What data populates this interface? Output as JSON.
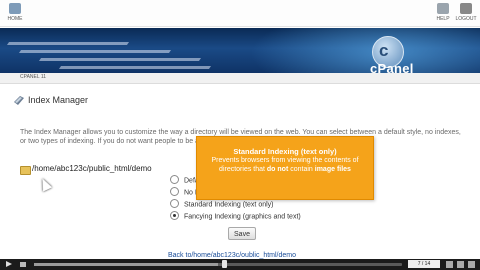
{
  "topbar": {
    "home_label": "HOME",
    "help_label": "HELP",
    "logout_label": "LOGOUT"
  },
  "brand": {
    "logo_letter": "c",
    "name": "cPanel"
  },
  "breadcrumb": {
    "text": "CPANEL 11"
  },
  "page": {
    "title": "Index Manager"
  },
  "description": "The Index Manager allows you to customize the way a directory will be viewed on the web. You can select between a default style, no indexes, or two types of indexing. If you do not want people to be able to see the files in your directory, choose no indexing.",
  "directory": {
    "path": "/home/abc123c/public_html/demo"
  },
  "options": [
    {
      "label": "Default System Setting",
      "selected": false
    },
    {
      "label": "No Indexing",
      "selected": false
    },
    {
      "label": "Standard Indexing (text only)",
      "selected": false
    },
    {
      "label": "Fancying Indexing (graphics and text)",
      "selected": true
    }
  ],
  "save_label": "Save",
  "back_link": "Back to/home/abc123c/oublic_html/demo",
  "tooltip": {
    "title": "Standard Indexing (text only)",
    "line1": "Prevents browsers from viewing the contents of directories that ",
    "emphasis": "do not",
    "line2": " contain ",
    "emphasis2": "image files"
  },
  "player": {
    "counter": "7 / 14",
    "progress": 0.5
  },
  "colors": {
    "tooltip_bg": "#f5a31a",
    "banner": "#0f3366",
    "link": "#1a4d99"
  },
  "icons": {
    "home": "home-icon",
    "help": "help-icon",
    "logout": "logout-icon"
  }
}
